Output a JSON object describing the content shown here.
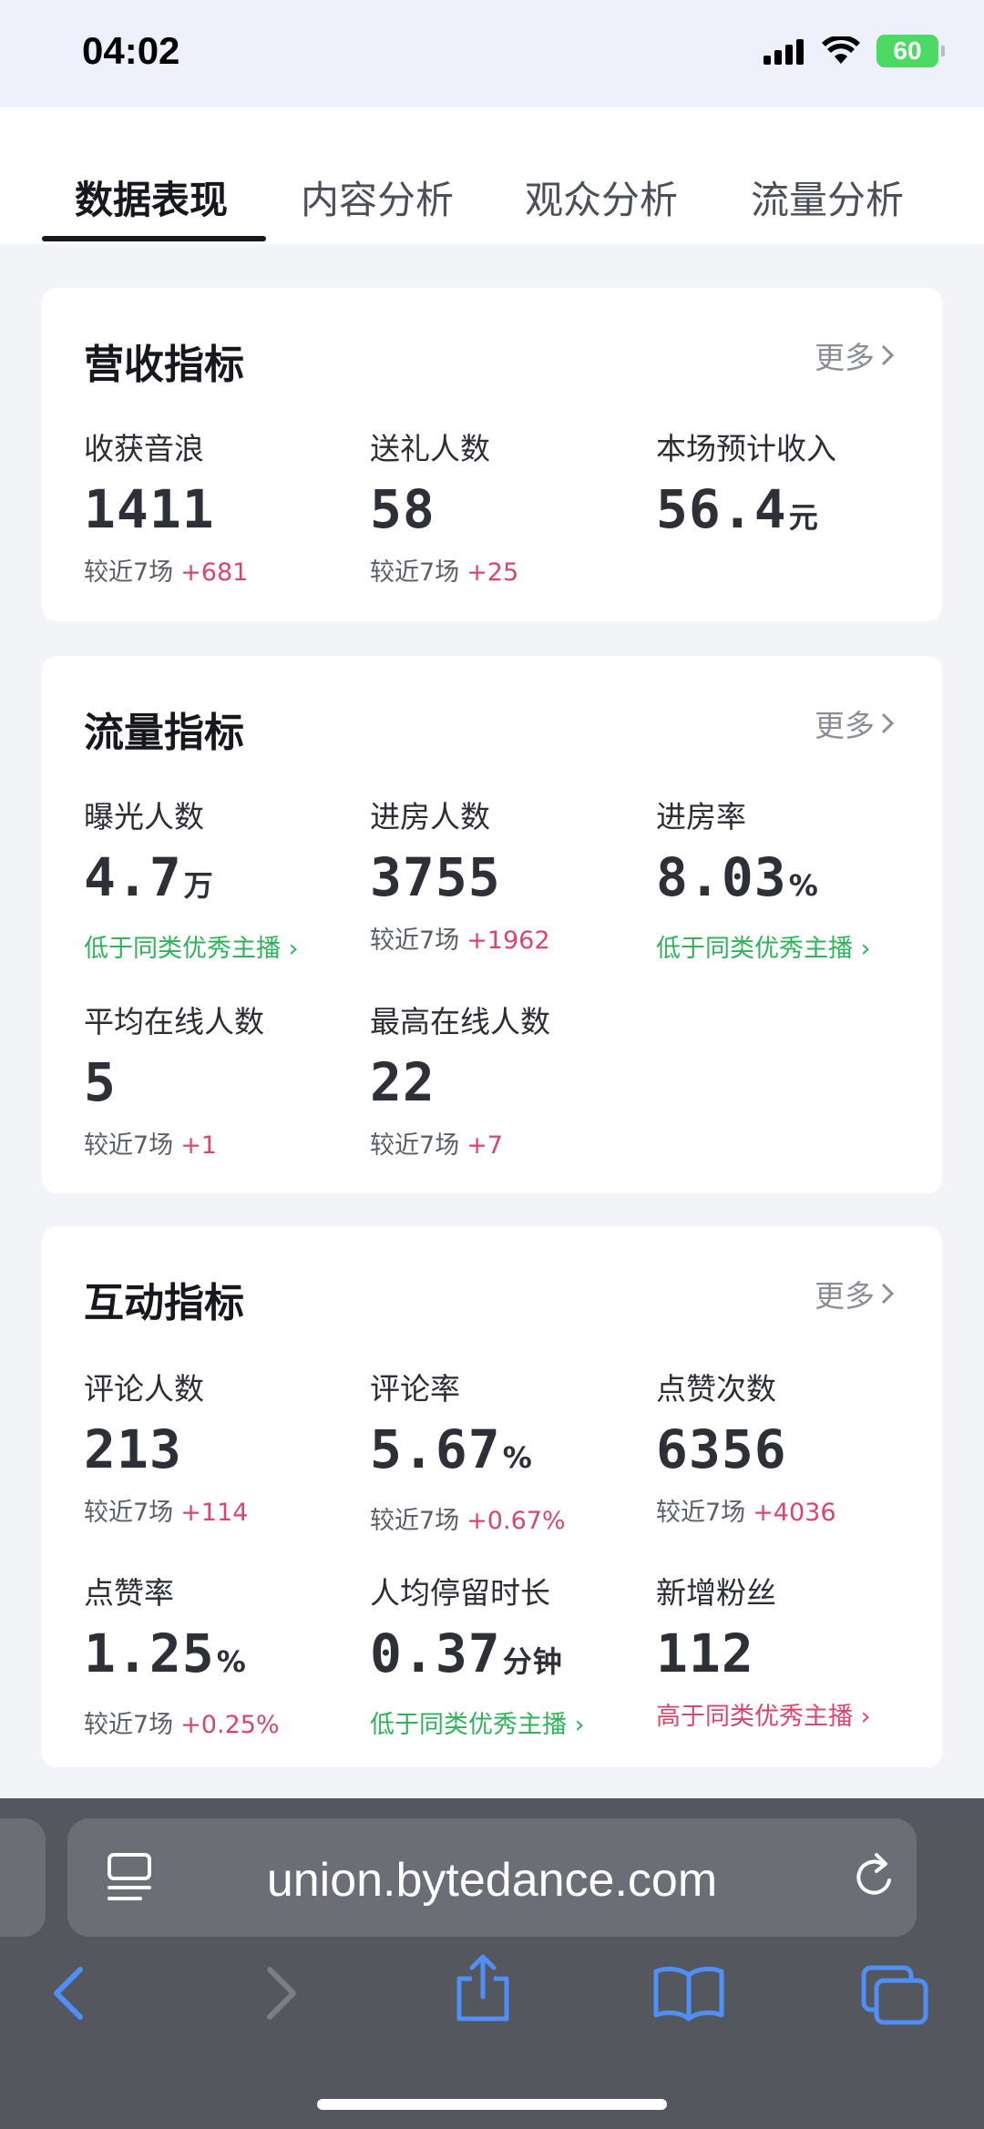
{
  "status_bar": {
    "time": "04:02",
    "battery": "60"
  },
  "tabs": [
    {
      "label": "数据表现",
      "active": true
    },
    {
      "label": "内容分析",
      "active": false
    },
    {
      "label": "观众分析",
      "active": false
    },
    {
      "label": "流量分析",
      "active": false
    }
  ],
  "more_label": "更多",
  "revenue": {
    "title": "营收指标",
    "metrics": [
      {
        "label": "收获音浪",
        "value": "1411",
        "unit": "",
        "compare": "较近7场",
        "delta": "+681"
      },
      {
        "label": "送礼人数",
        "value": "58",
        "unit": "",
        "compare": "较近7场",
        "delta": "+25"
      },
      {
        "label": "本场预计收入",
        "value": "56.4",
        "unit": "元"
      }
    ]
  },
  "traffic": {
    "title": "流量指标",
    "metrics": [
      {
        "label": "曝光人数",
        "value": "4.7",
        "unit": "万",
        "note": "低于同类优秀主播"
      },
      {
        "label": "进房人数",
        "value": "3755",
        "unit": "",
        "compare": "较近7场",
        "delta": "+1962"
      },
      {
        "label": "进房率",
        "value": "8.03",
        "unit": "%",
        "note": "低于同类优秀主播"
      },
      {
        "label": "平均在线人数",
        "value": "5",
        "unit": "",
        "compare": "较近7场",
        "delta": "+1"
      },
      {
        "label": "最高在线人数",
        "value": "22",
        "unit": "",
        "compare": "较近7场",
        "delta": "+7"
      }
    ]
  },
  "interaction": {
    "title": "互动指标",
    "metrics": [
      {
        "label": "评论人数",
        "value": "213",
        "unit": "",
        "compare": "较近7场",
        "delta": "+114"
      },
      {
        "label": "评论率",
        "value": "5.67",
        "unit": "%",
        "compare": "较近7场",
        "delta": "+0.67%"
      },
      {
        "label": "点赞次数",
        "value": "6356",
        "unit": "",
        "compare": "较近7场",
        "delta": "+4036"
      },
      {
        "label": "点赞率",
        "value": "1.25",
        "unit": "%",
        "compare": "较近7场",
        "delta": "+0.25%"
      },
      {
        "label": "人均停留时长",
        "value": "0.37",
        "unit": "分钟",
        "note": "低于同类优秀主播"
      },
      {
        "label": "新增粉丝",
        "value": "112",
        "unit": "",
        "note": "高于同类优秀主播"
      }
    ]
  },
  "browser": {
    "url": "union.bytedance.com"
  },
  "colors": {
    "delta_red": "#d9456b",
    "note_green": "#2fb259",
    "browser_bg": "#55575e",
    "ios_blue": "#4f8ff7"
  },
  "icons": [
    "cellular-icon",
    "wifi-icon",
    "battery-icon",
    "chevron-right-icon",
    "reader-icon",
    "reload-icon",
    "back-icon",
    "forward-icon",
    "share-icon",
    "bookmarks-icon",
    "tabs-icon"
  ]
}
